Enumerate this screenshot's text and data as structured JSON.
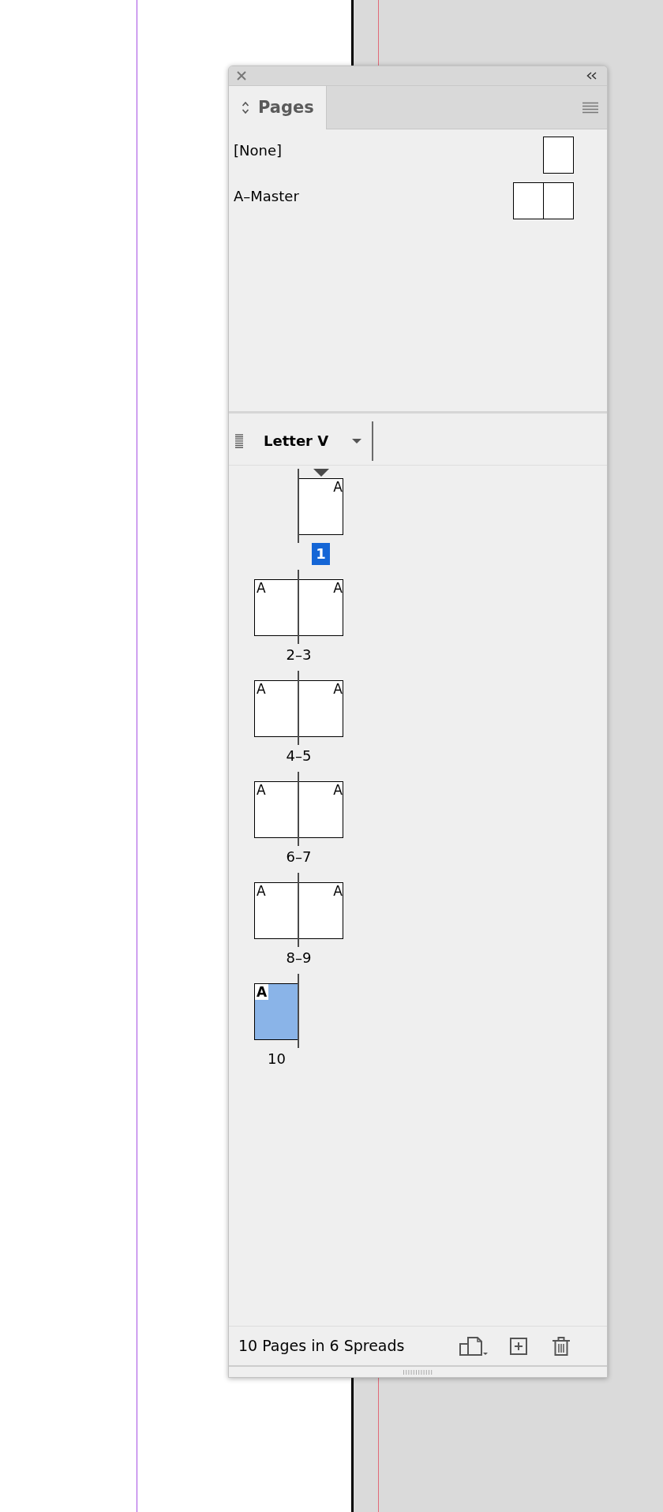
{
  "panel": {
    "tabs": [
      {
        "label": "Pages",
        "selected": true
      }
    ]
  },
  "masters": [
    {
      "name": "[None]",
      "kind": "single"
    },
    {
      "name": "A–Master",
      "kind": "spread"
    }
  ],
  "toolbar": {
    "page_size": "Letter V"
  },
  "spreads": [
    {
      "label": "1",
      "current": true,
      "section_start": true,
      "pages": [
        {
          "kind": "right",
          "master": "A",
          "selected": false
        }
      ]
    },
    {
      "label": "2–3",
      "current": false,
      "section_start": false,
      "pages": [
        {
          "kind": "left",
          "master": "A",
          "selected": false
        },
        {
          "kind": "right",
          "master": "A",
          "selected": false
        }
      ]
    },
    {
      "label": "4–5",
      "current": false,
      "section_start": false,
      "pages": [
        {
          "kind": "left",
          "master": "A",
          "selected": false
        },
        {
          "kind": "right",
          "master": "A",
          "selected": false
        }
      ]
    },
    {
      "label": "6–7",
      "current": false,
      "section_start": false,
      "pages": [
        {
          "kind": "left",
          "master": "A",
          "selected": false
        },
        {
          "kind": "right",
          "master": "A",
          "selected": false
        }
      ]
    },
    {
      "label": "8–9",
      "current": false,
      "section_start": false,
      "pages": [
        {
          "kind": "left",
          "master": "A",
          "selected": false
        },
        {
          "kind": "right",
          "master": "A",
          "selected": false
        }
      ]
    },
    {
      "label": "10",
      "current": false,
      "section_start": false,
      "pages": [
        {
          "kind": "left",
          "master": "A",
          "selected": true
        }
      ]
    }
  ],
  "status_bar": {
    "text": "10 Pages in 6 Spreads"
  }
}
